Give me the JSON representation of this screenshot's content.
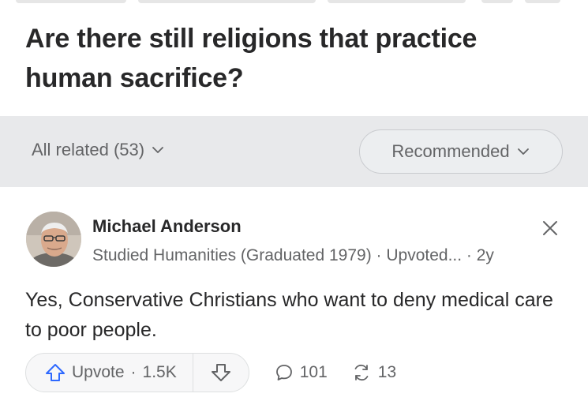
{
  "question": {
    "title": "Are there still religions that practice human sacrifice?"
  },
  "filters": {
    "all_related": "All related (53)",
    "sort": "Recommended"
  },
  "answer": {
    "author": "Michael Anderson",
    "credential": "Studied Humanities (Graduated 1979) · Upvoted... · 2y",
    "text": "Yes, Conservative Christians who want to deny medical care to poor people.",
    "upvote_label": "Upvote",
    "upvote_count": "1.5K",
    "comments": "101",
    "shares": "13"
  },
  "colors": {
    "text_primary": "#282829",
    "text_secondary": "#636466",
    "filter_bar": "#e8e9eb",
    "upvote_icon": "#2e69ff"
  },
  "icons": {
    "dropdown": "chevron-down-icon",
    "close": "close-icon",
    "upvote": "upvote-arrow-icon",
    "downvote": "downvote-arrow-icon",
    "comment": "comment-bubble-icon",
    "share": "share-icon"
  }
}
